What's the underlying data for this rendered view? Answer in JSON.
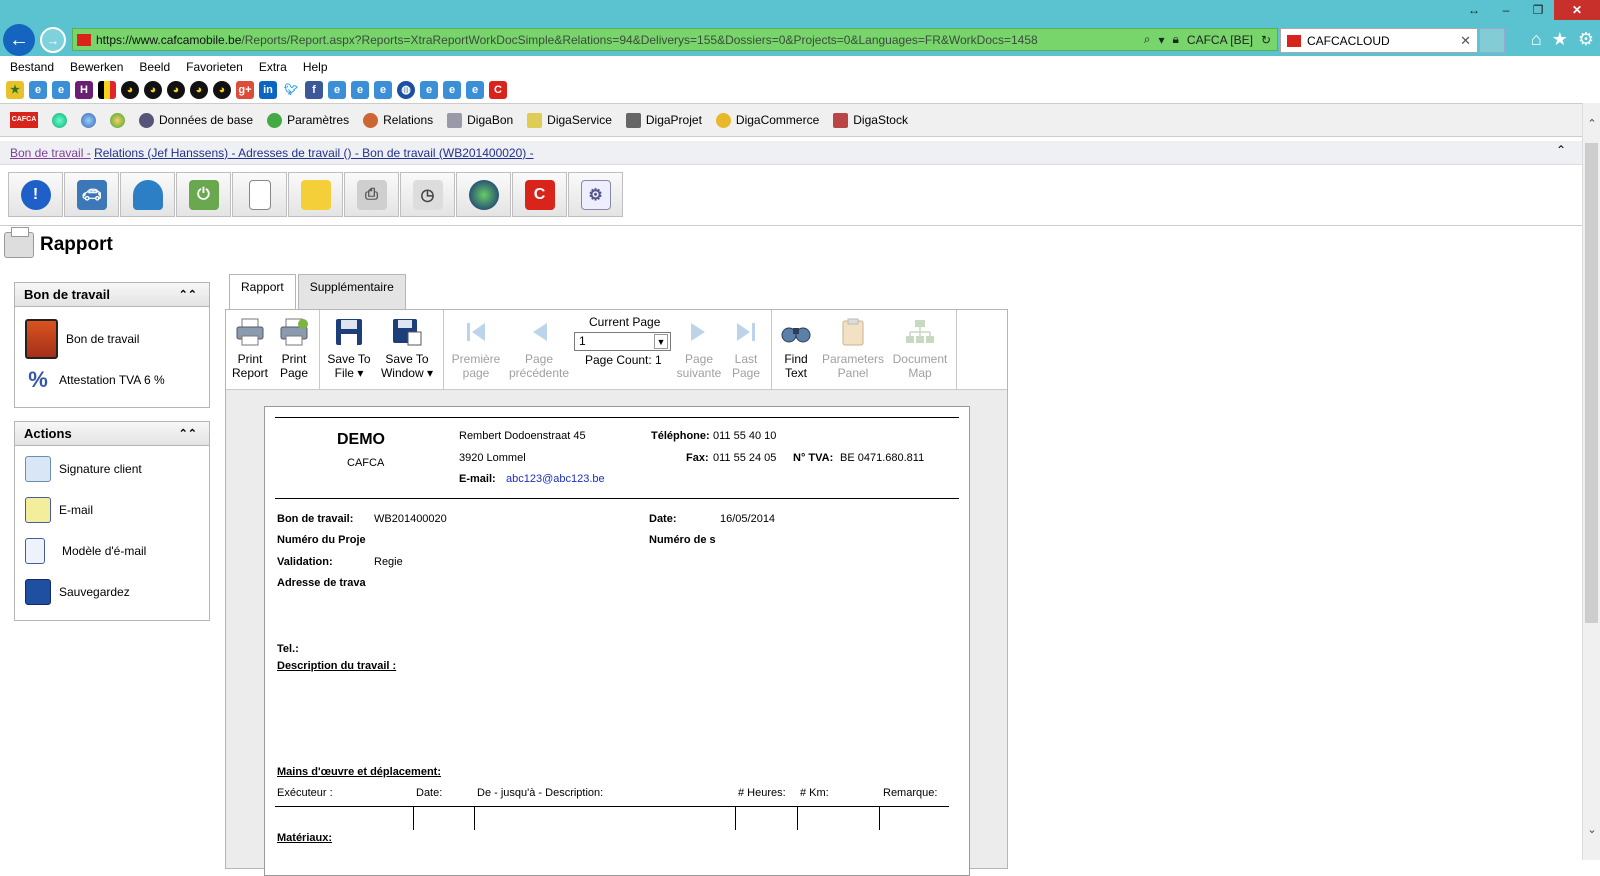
{
  "browser": {
    "url_host": "https://www.cafcamobile.be",
    "url_path": "/Reports/Report.aspx?Reports=XtraReportWorkDocSimple&Relations=94&Deliverys=155&Dossiers=0&Projects=0&Languages=FR&WorkDocs=1458",
    "site_badge": "CAFCA [BE]",
    "tab_title": "CAFCACLOUD",
    "menu": [
      "Bestand",
      "Bewerken",
      "Beeld",
      "Favorieten",
      "Extra",
      "Help"
    ]
  },
  "appbar": {
    "items": [
      "Données de base",
      "Paramètres",
      "Relations",
      "DigaBon",
      "DigaService",
      "DigaProjet",
      "DigaCommerce",
      "DigaStock"
    ],
    "logo": "CAFCA"
  },
  "breadcrumb": {
    "first": "Bon de travail -",
    "rest": "Relations (Jef Hanssens) - Adresses de travail () - Bon de travail (WB201400020) -"
  },
  "page": {
    "title": "Rapport"
  },
  "left_panel": {
    "docs_header": "Bon de travail",
    "docs": [
      "Bon de travail",
      "Attestation TVA 6 %"
    ],
    "actions_header": "Actions",
    "actions": [
      "Signature client",
      "E-mail",
      "Modèle d'é-mail",
      "Sauvegardez"
    ]
  },
  "tabs": {
    "report": "Rapport",
    "extra": "Supplémentaire"
  },
  "viewer_toolbar": {
    "print_report": [
      "Print",
      "Report"
    ],
    "print_page": [
      "Print",
      "Page"
    ],
    "save_file": [
      "Save To",
      "File"
    ],
    "save_window": [
      "Save To",
      "Window"
    ],
    "first_page": [
      "Première",
      "page"
    ],
    "prev_page": [
      "Page",
      "précédente"
    ],
    "current_page_label": "Current Page",
    "current_page_value": "1",
    "page_count": "Page Count: 1",
    "next_page": [
      "Page",
      "suivante"
    ],
    "last_page": [
      "Last",
      "Page"
    ],
    "find_text": [
      "Find",
      "Text"
    ],
    "parameters": [
      "Parameters",
      "Panel"
    ],
    "document_map": [
      "Document",
      "Map"
    ]
  },
  "report": {
    "company": "DEMO",
    "company_sub": "CAFCA",
    "street": "Rembert Dodoenstraat 45",
    "city": "3920 Lommel",
    "email_label": "E-mail:",
    "email": "abc123@abc123.be",
    "phone_label": "Téléphone:",
    "phone": "011 55 40 10",
    "fax_label": "Fax:",
    "fax": "011 55 24 05",
    "vat_label": "N° TVA:",
    "vat": "BE 0471.680.811",
    "bon_label": "Bon de travail:",
    "bon_value": "WB201400020",
    "date_label": "Date:",
    "date_value": "16/05/2014",
    "proj_label": "Numéro du Proje",
    "serie_label": "Numéro de s",
    "valid_label": "Validation:",
    "valid_value": "Regie",
    "addr_label": "Adresse de trava",
    "tel_label": "Tel.:",
    "desc_label": "Description du travail :",
    "labor_label": "Mains d'œuvre et déplacement:",
    "col_exec": "Exécuteur :",
    "col_date": "Date:",
    "col_desc": "De - jusqu'à - Description:",
    "col_hours": "# Heures:",
    "col_km": "# Km:",
    "col_remark": "Remarque:",
    "materials_label": "Matériaux:"
  },
  "colors": {
    "ie_bar": "#5bc3d0",
    "address_bar": "#77d56c",
    "brand": "#d9241b",
    "link": "#22318e"
  }
}
